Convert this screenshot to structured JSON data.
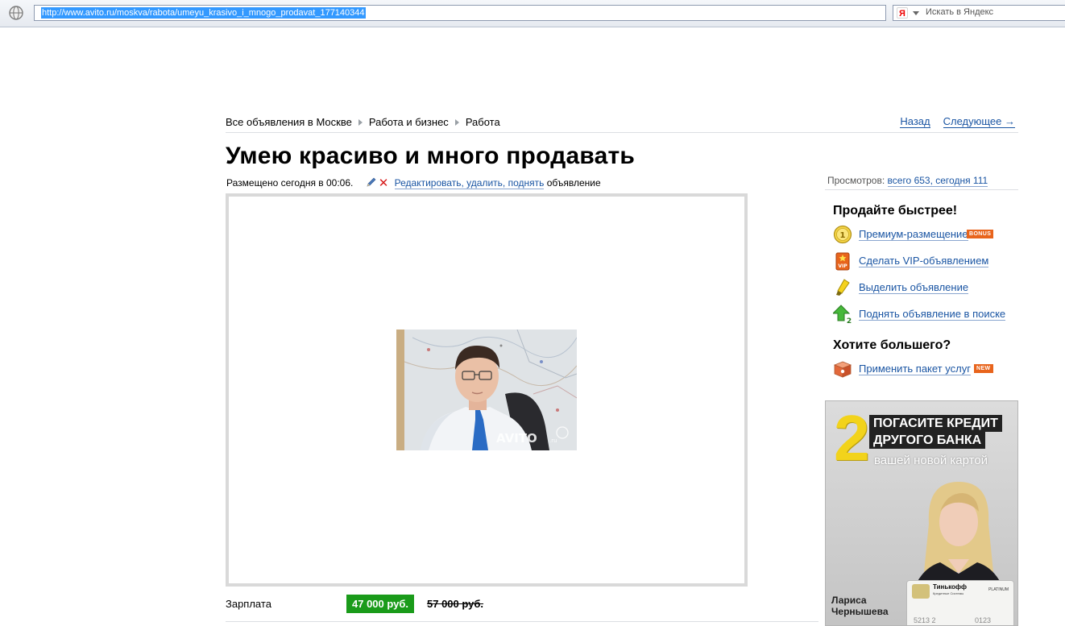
{
  "browser": {
    "url": "http://www.avito.ru/moskva/rabota/umeyu_krasivo_i_mnogo_prodavat_177140344",
    "search_placeholder": "Искать в Яндекс",
    "search_engine_glyph": "Я"
  },
  "breadcrumbs": [
    "Все объявления в Москве",
    "Работа и бизнес",
    "Работа"
  ],
  "nav": {
    "back": "Назад",
    "next": "Следующее →"
  },
  "ad": {
    "title": "Умею красиво и много продавать",
    "posted": "Размещено сегодня в 00:06.",
    "edit_link": "Редактировать, удалить, поднять",
    "edit_suffix": "объявление",
    "salary_label": "Зарплата",
    "price": "47 000 руб.",
    "old_price": "57 000 руб.",
    "watermark": "AVITO",
    "watermark_suffix": ".ru"
  },
  "views": {
    "label": "Просмотров:",
    "value": "всего 653, сегодня 111"
  },
  "sidebar": {
    "sell_faster_heading": "Продайте быстрее!",
    "services": [
      {
        "icon": "coin-icon",
        "label": "Премиум-размещение",
        "badge": "BONUS"
      },
      {
        "icon": "vip-icon",
        "label": "Сделать VIP-объявлением",
        "badge": ""
      },
      {
        "icon": "highlighter-icon",
        "label": "Выделить объявление",
        "badge": ""
      },
      {
        "icon": "up-arrow-icon",
        "label": "Поднять объявление в поиске",
        "badge": ""
      }
    ],
    "more_heading": "Хотите большего?",
    "package": {
      "icon": "package-icon",
      "label": "Применить пакет услуг",
      "badge": "NEW"
    }
  },
  "banner": {
    "number": "2",
    "line1": "ПОГАСИТЕ КРЕДИТ",
    "line2": "ДРУГОГО БАНКА",
    "subtitle": "вашей новой картой",
    "person_first": "Лариса",
    "person_last": "Чернышева",
    "card_brand": "Тинькофф",
    "card_sub": "Кредитные Системы",
    "card_tier": "PLATINUM",
    "card_number": "5213 2",
    "card_number_end": "0123"
  },
  "colors": {
    "link": "#1a55a3",
    "price_bg": "#1a9b1a",
    "badge": "#e8641c",
    "banner_yellow": "#f2d31b"
  }
}
